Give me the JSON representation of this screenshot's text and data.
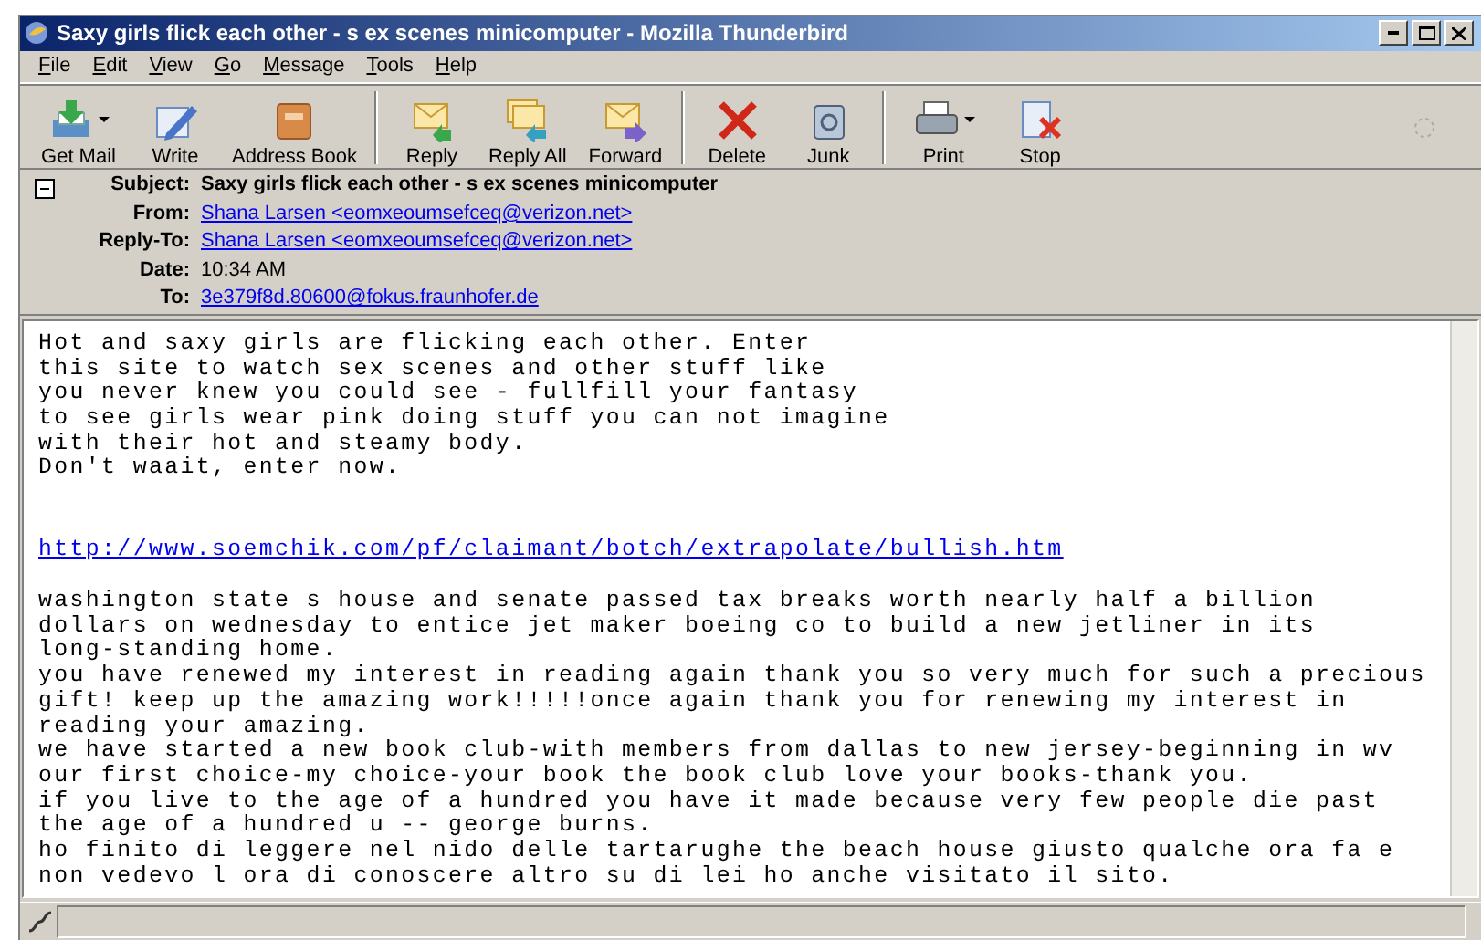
{
  "window": {
    "title": "Saxy girls flick each other - s ex scenes minicomputer - Mozilla Thunderbird"
  },
  "menu": [
    {
      "label": "File"
    },
    {
      "label": "Edit"
    },
    {
      "label": "View"
    },
    {
      "label": "Go"
    },
    {
      "label": "Message"
    },
    {
      "label": "Tools"
    },
    {
      "label": "Help"
    }
  ],
  "toolbar": [
    [
      {
        "label": "Get Mail",
        "kind": "getmail",
        "dropdown": true
      },
      {
        "label": "Write",
        "kind": "write",
        "dropdown": false
      },
      {
        "label": "Address Book",
        "kind": "book",
        "dropdown": false
      }
    ],
    [
      {
        "label": "Reply",
        "kind": "reply",
        "dropdown": false
      },
      {
        "label": "Reply All",
        "kind": "replyall",
        "dropdown": false
      },
      {
        "label": "Forward",
        "kind": "forward",
        "dropdown": false
      }
    ],
    [
      {
        "label": "Delete",
        "kind": "delete",
        "dropdown": false
      },
      {
        "label": "Junk",
        "kind": "junk",
        "dropdown": false
      }
    ],
    [
      {
        "label": "Print",
        "kind": "print",
        "dropdown": true
      },
      {
        "label": "Stop",
        "kind": "stop",
        "dropdown": false
      }
    ]
  ],
  "header": {
    "expanded": true,
    "fields": [
      {
        "label": "Subject:",
        "value": "Saxy girls flick each other - s ex scenes minicomputer",
        "kind": "bold"
      },
      {
        "label": "From:",
        "value": "Shana Larsen <eomxeoumsefceq@verizon.net>",
        "kind": "link"
      },
      {
        "label": "Reply-To:",
        "value": "Shana Larsen <eomxeoumsefceq@verizon.net>",
        "kind": "link"
      },
      {
        "label": "Date:",
        "value": "10:34 AM",
        "kind": "plain"
      },
      {
        "label": "To:",
        "value": "3e379f8d.80600@fokus.fraunhofer.de",
        "kind": "link"
      }
    ]
  },
  "body": [
    {
      "kind": "text",
      "lines": [
        "Hot and saxy girls are flicking each other. Enter",
        "this site to watch sex scenes and other stuff like",
        "you never knew you could see - fullfill your fantasy",
        "to see girls wear pink doing stuff you can not imagine",
        "with their hot and steamy body.",
        "Don't waait, enter now."
      ]
    },
    {
      "kind": "link",
      "lines": [
        "http://www.soemchik.com/pf/claimant/botch/extrapolate/bullish.htm"
      ]
    },
    {
      "kind": "text",
      "lines": [
        "washington state s house and senate passed tax breaks worth nearly half a billion",
        "dollars on wednesday to entice jet maker boeing co to build a new jetliner in its",
        "long-standing home.",
        "you have renewed my interest in reading again thank you so very much for such a precious",
        "gift! keep up the amazing work!!!!!once again thank you for renewing my interest in",
        "reading your amazing.",
        "we have started a new book club-with members from dallas to new jersey-beginning in wv",
        "our first choice-my choice-your book the book club love your books-thank you.",
        "if you live to the age of a hundred you have it made because very few people die past",
        "the age of a hundred u -- george burns.",
        "ho finito di leggere nel nido delle tartarughe the beach house giusto qualche ora fa e",
        "non vedevo l ora di conoscere altro su di lei ho anche visitato il sito."
      ]
    }
  ]
}
